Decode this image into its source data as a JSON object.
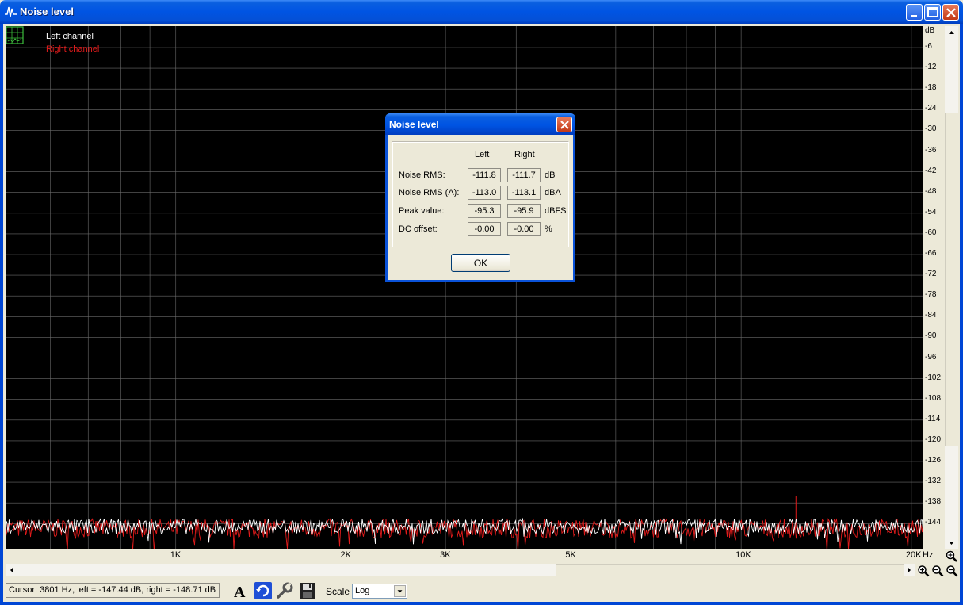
{
  "window": {
    "title": "Noise level"
  },
  "legend": {
    "left": "Left channel",
    "right": "Right channel",
    "left_color": "#ffffff",
    "right_color": "#e21b1b"
  },
  "chart_data": {
    "type": "line",
    "xscale": "log",
    "xunit": "Hz",
    "yunit": "dB",
    "ylim": [
      -147,
      -3
    ],
    "xlim": [
      500,
      21000
    ],
    "grid": true,
    "x_ticks": [
      "1K",
      "2K",
      "3K",
      "5K",
      "10K",
      "20K"
    ],
    "x_tick_values": [
      1000,
      2000,
      3000,
      5000,
      10000,
      20000
    ],
    "y_ticks": [
      "dB",
      "-6",
      "-12",
      "-18",
      "-24",
      "-30",
      "-36",
      "-42",
      "-48",
      "-54",
      "-60",
      "-66",
      "-72",
      "-78",
      "-84",
      "-90",
      "-96",
      "-102",
      "-108",
      "-114",
      "-120",
      "-126",
      "-132",
      "-138",
      "-144"
    ],
    "series": [
      {
        "name": "Left channel",
        "color": "#ffffff",
        "mean_db": -144.8,
        "spread_db": 2.2
      },
      {
        "name": "Right channel",
        "color": "#e21b1b",
        "mean_db": -145.4,
        "spread_db": 2.8,
        "spike": {
          "x": 12500,
          "y": -136
        }
      }
    ]
  },
  "toolbar": {
    "cursor": "Cursor:  3801 Hz,  left = -147.44 dB,  right = -148.71 dB",
    "scale_label": "Scale",
    "scale_value": "Log",
    "icons": [
      "font-icon",
      "refresh-icon",
      "wrench-icon",
      "save-icon"
    ]
  },
  "dialog": {
    "title": "Noise level",
    "col_left": "Left",
    "col_right": "Right",
    "rows": [
      {
        "label": "Noise RMS:",
        "left": "-111.8",
        "right": "-111.7",
        "unit": "dB"
      },
      {
        "label": "Noise RMS (A):",
        "left": "-113.0",
        "right": "-113.1",
        "unit": "dBA"
      },
      {
        "label": "Peak value:",
        "left": "-95.3",
        "right": "-95.9",
        "unit": "dBFS"
      },
      {
        "label": "DC offset:",
        "left": "-0.00",
        "right": "-0.00",
        "unit": "%"
      }
    ],
    "ok": "OK"
  }
}
